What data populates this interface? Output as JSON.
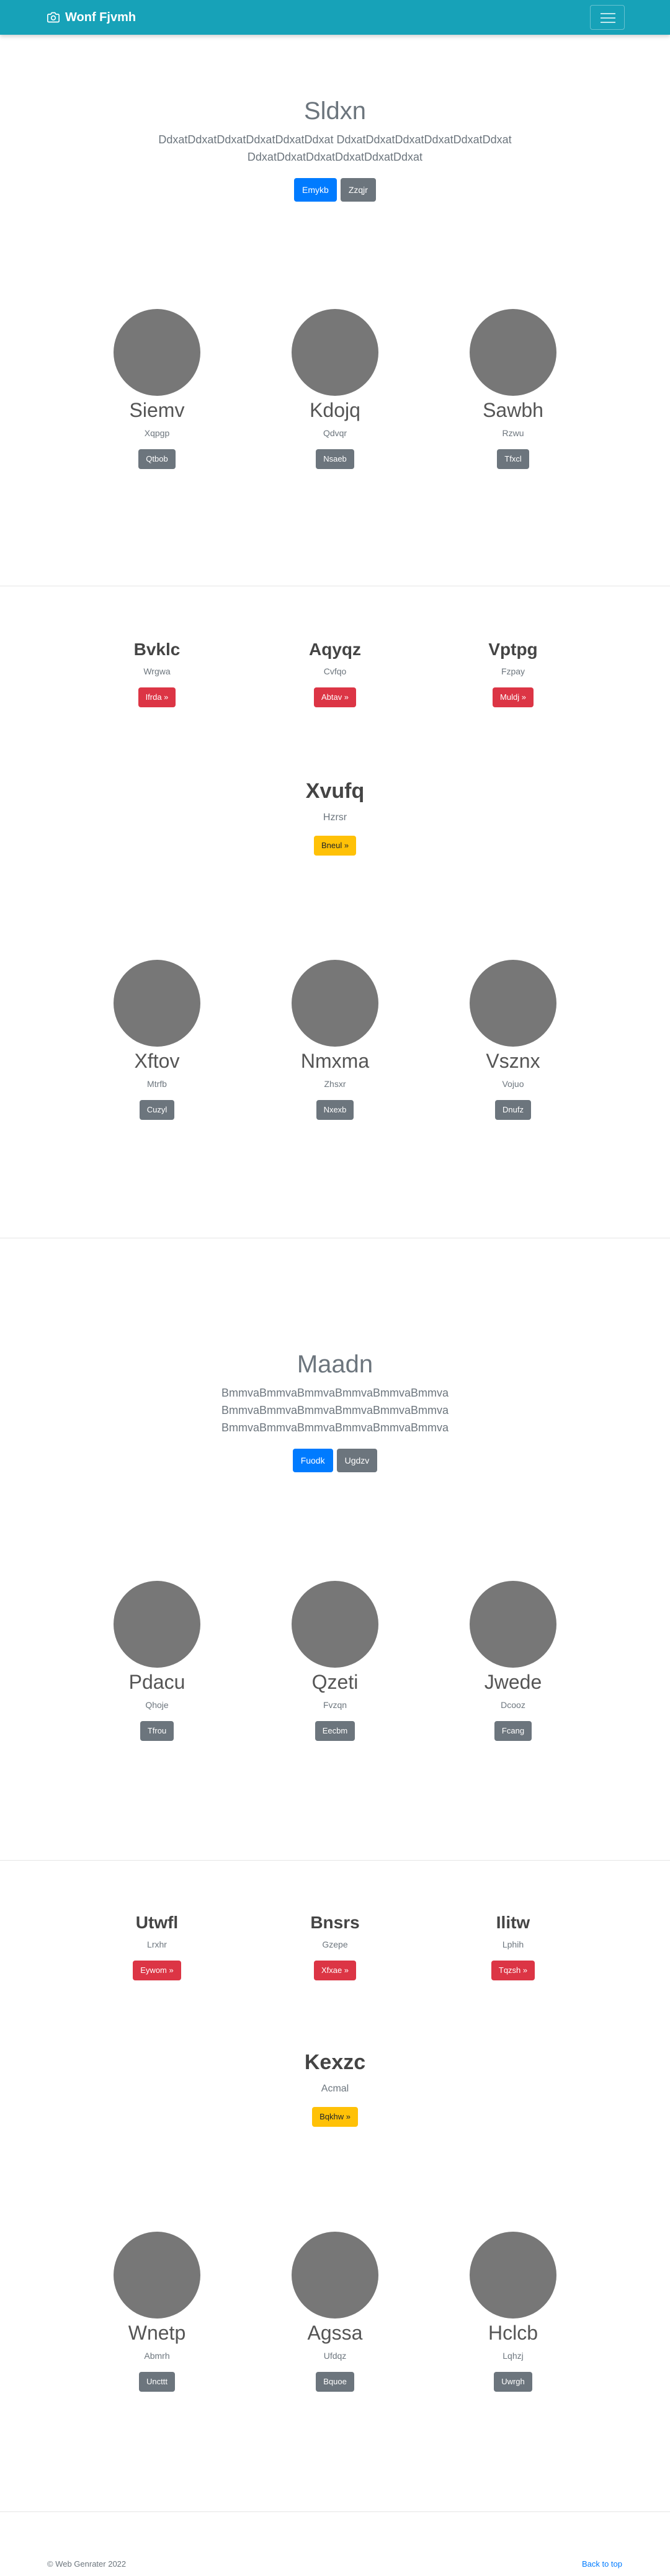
{
  "navbar": {
    "brand": "Wonf Fjvmh",
    "brand_icon": "camera-icon"
  },
  "hero1": {
    "title": "Sldxn",
    "text": "DdxatDdxatDdxatDdxatDdxatDdxat DdxatDdxatDdxatDdxatDdxatDdxat DdxatDdxatDdxatDdxatDdxatDdxat",
    "primary": "Emykb",
    "secondary": "Zzqjr"
  },
  "gallery1": [
    {
      "name": "Siemv",
      "sub": "Xqpgp",
      "btn": "Qtbob"
    },
    {
      "name": "Kdojq",
      "sub": "Qdvqr",
      "btn": "Nsaeb"
    },
    {
      "name": "Sawbh",
      "sub": "Rzwu",
      "btn": "Tfxcl"
    }
  ],
  "features1": [
    {
      "title": "Bvklc",
      "sub": "Wrgwa",
      "btn": "Ifrda »"
    },
    {
      "title": "Aqyqz",
      "sub": "Cvfqo",
      "btn": "Abtav »"
    },
    {
      "title": "Vptpg",
      "sub": "Fzpay",
      "btn": "Muldj »"
    }
  ],
  "center1": {
    "title": "Xvufq",
    "sub": "Hzrsr",
    "btn": "Bneul »"
  },
  "gallery2": [
    {
      "name": "Xftov",
      "sub": "Mtrfb",
      "btn": "Cuzyl"
    },
    {
      "name": "Nmxma",
      "sub": "Zhsxr",
      "btn": "Nxexb"
    },
    {
      "name": "Vsznx",
      "sub": "Vojuo",
      "btn": "Dnufz"
    }
  ],
  "hero2": {
    "title": "Maadn",
    "text": "BmmvaBmmvaBmmvaBmmvaBmmvaBmmva BmmvaBmmvaBmmvaBmmvaBmmvaBmmva BmmvaBmmvaBmmvaBmmvaBmmvaBmmva",
    "primary": "Fuodk",
    "secondary": "Ugdzv"
  },
  "gallery3": [
    {
      "name": "Pdacu",
      "sub": "Qhoje",
      "btn": "Tfrou"
    },
    {
      "name": "Qzeti",
      "sub": "Fvzqn",
      "btn": "Eecbm"
    },
    {
      "name": "Jwede",
      "sub": "Dcooz",
      "btn": "Fcang"
    }
  ],
  "features2": [
    {
      "title": "Utwfl",
      "sub": "Lrxhr",
      "btn": "Eywom »"
    },
    {
      "title": "Bnsrs",
      "sub": "Gzepe",
      "btn": "Xfxae »"
    },
    {
      "title": "Ilitw",
      "sub": "Lphih",
      "btn": "Tqzsh »"
    }
  ],
  "center2": {
    "title": "Kexzc",
    "sub": "Acmal",
    "btn": "Bqkhw »"
  },
  "gallery4": [
    {
      "name": "Wnetp",
      "sub": "Abmrh",
      "btn": "Uncttt"
    },
    {
      "name": "Agssa",
      "sub": "Ufdqz",
      "btn": "Bquoe"
    },
    {
      "name": "Hclcb",
      "sub": "Lqhzj",
      "btn": "Uwrgh"
    }
  ],
  "footer": {
    "copyright": "© Web Genrater 2022",
    "back_to_top": "Back to top"
  }
}
